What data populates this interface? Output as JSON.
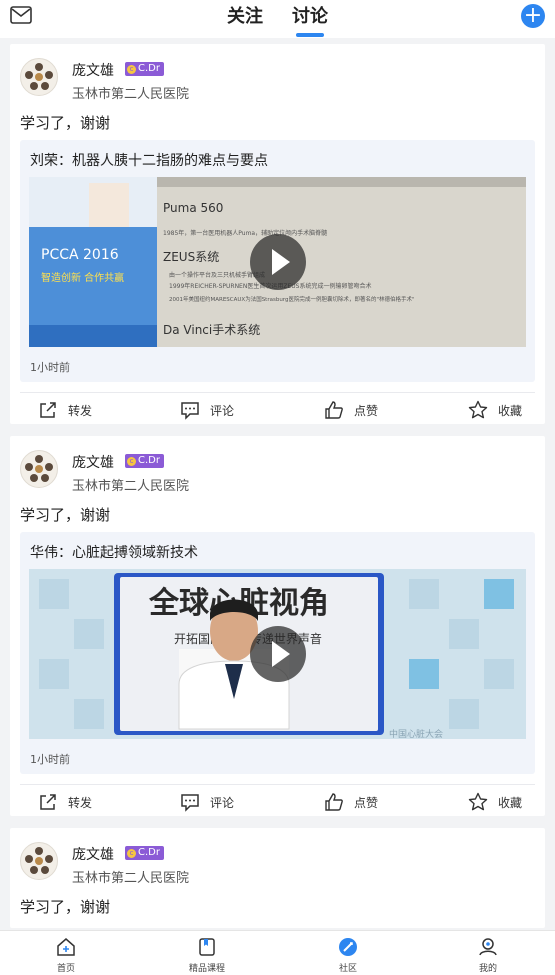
{
  "header": {
    "tabs": [
      "关注",
      "讨论"
    ],
    "active_tab": "讨论",
    "icons": {
      "left": "mail-icon",
      "right": "plus-icon"
    },
    "accent_color": "#2d86f0"
  },
  "posts": [
    {
      "author": "庞文雄",
      "badge": "C.Dr",
      "hospital": "玉林市第二人民医院",
      "text": "学习了，谢谢",
      "shared": {
        "title": "刘荣：机器人胰十二指肠的难点与要点",
        "video_text": {
          "poster_title": "PCCA 2016",
          "poster_sub": "智造创新  合作共赢",
          "line1": "Puma 560",
          "line2": "1985年，第一台医用机器人Puma，辅助定位颅内手术脑脊髓",
          "line3": "ZEUS系统",
          "line4": "由一个操作平台及三只机械手臂组成",
          "line5": "1999年REICHER-SPURNEN医生首次运用ZEUS系统完成一例输卵管吻合术",
          "line6": "2001年美国纽约MARESCAUX为法国Strasburg医院完成一例胆囊切除术，即著名的\"林德伯格手术\"",
          "line7": "Da Vinci手术系统"
        },
        "time": "1小时前"
      },
      "actions": [
        "转发",
        "评论",
        "点赞",
        "收藏"
      ]
    },
    {
      "author": "庞文雄",
      "badge": "C.Dr",
      "hospital": "玉林市第二人民医院",
      "text": "学习了，谢谢",
      "shared": {
        "title": "华伟：心脏起搏领域新技术",
        "video_text": {
          "banner": "全球心脏视角",
          "slogan": "开拓国际视野 传递世界声音",
          "watermark": "中国心脏大会"
        },
        "time": "1小时前"
      },
      "actions": [
        "转发",
        "评论",
        "点赞",
        "收藏"
      ]
    },
    {
      "author": "庞文雄",
      "badge": "C.Dr",
      "hospital": "玉林市第二人民医院",
      "text": "学习了，谢谢"
    }
  ],
  "bottom_nav": [
    {
      "label": "首页",
      "icon": "home-icon"
    },
    {
      "label": "精品课程",
      "icon": "course-icon"
    },
    {
      "label": "社区",
      "icon": "community-icon"
    },
    {
      "label": "我的",
      "icon": "profile-icon"
    }
  ],
  "active_nav": "社区"
}
